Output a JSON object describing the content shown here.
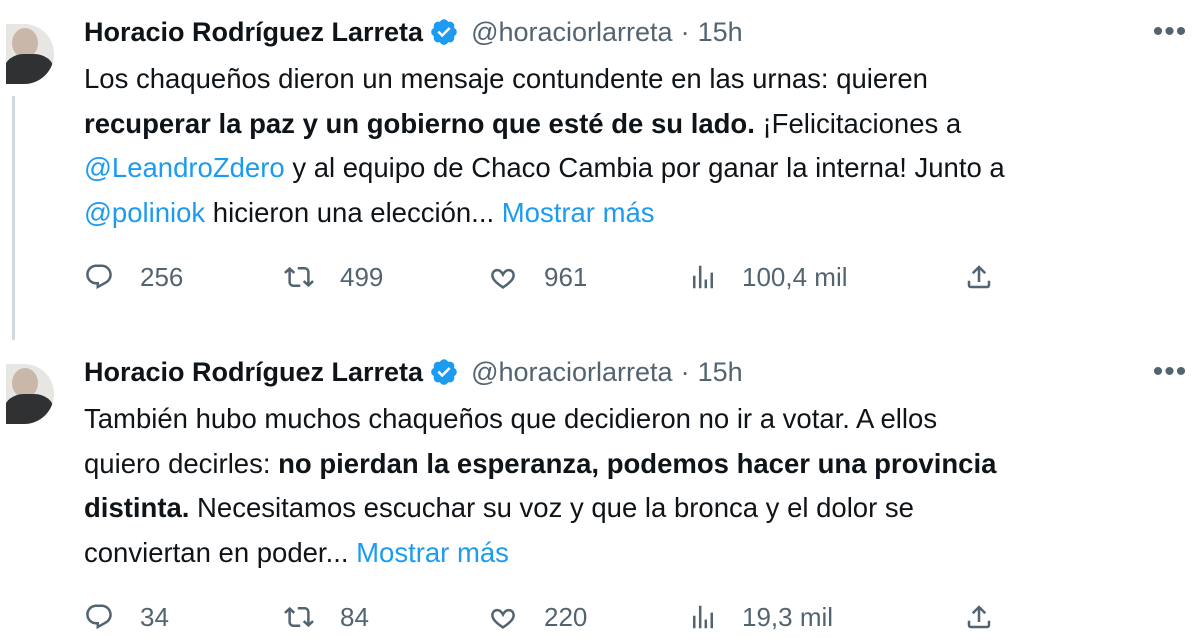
{
  "colors": {
    "accent": "#1d9bf0",
    "text": "#0f1419",
    "secondary": "#536471"
  },
  "tweets": [
    {
      "author_name": "Horacio Rodríguez Larreta",
      "handle": "@horaciorlarreta",
      "separator": "·",
      "time": "15h",
      "more_icon": "more-icon",
      "text": {
        "p1": "Los chaqueños dieron un mensaje contundente en las urnas: quieren",
        "bold1": "recuperar la paz y un gobierno que esté de su lado.",
        "p2": " ¡Felicitaciones a",
        "mention1": "@LeandroZdero",
        "p3": " y al equipo de Chaco Cambia por ganar la interna! Junto a",
        "mention2": "@poliniok",
        "p4": " hicieron una elección...",
        "show_more": "Mostrar más"
      },
      "replies": "256",
      "retweets": "499",
      "likes": "961",
      "views": "100,4 mil"
    },
    {
      "author_name": "Horacio Rodríguez Larreta",
      "handle": "@horaciorlarreta",
      "separator": "·",
      "time": "15h",
      "more_icon": "more-icon",
      "text": {
        "p1": "También hubo muchos chaqueños que decidieron no ir a votar. A ellos",
        "p2": "quiero decirles: ",
        "bold1": "no pierdan la esperanza, podemos hacer una provincia",
        "bold2": "distinta.",
        "p3": " Necesitamos escuchar su voz y que la bronca y el dolor se",
        "p4": "conviertan en poder...",
        "show_more": "Mostrar más"
      },
      "replies": "34",
      "retweets": "84",
      "likes": "220",
      "views": "19,3 mil"
    }
  ]
}
